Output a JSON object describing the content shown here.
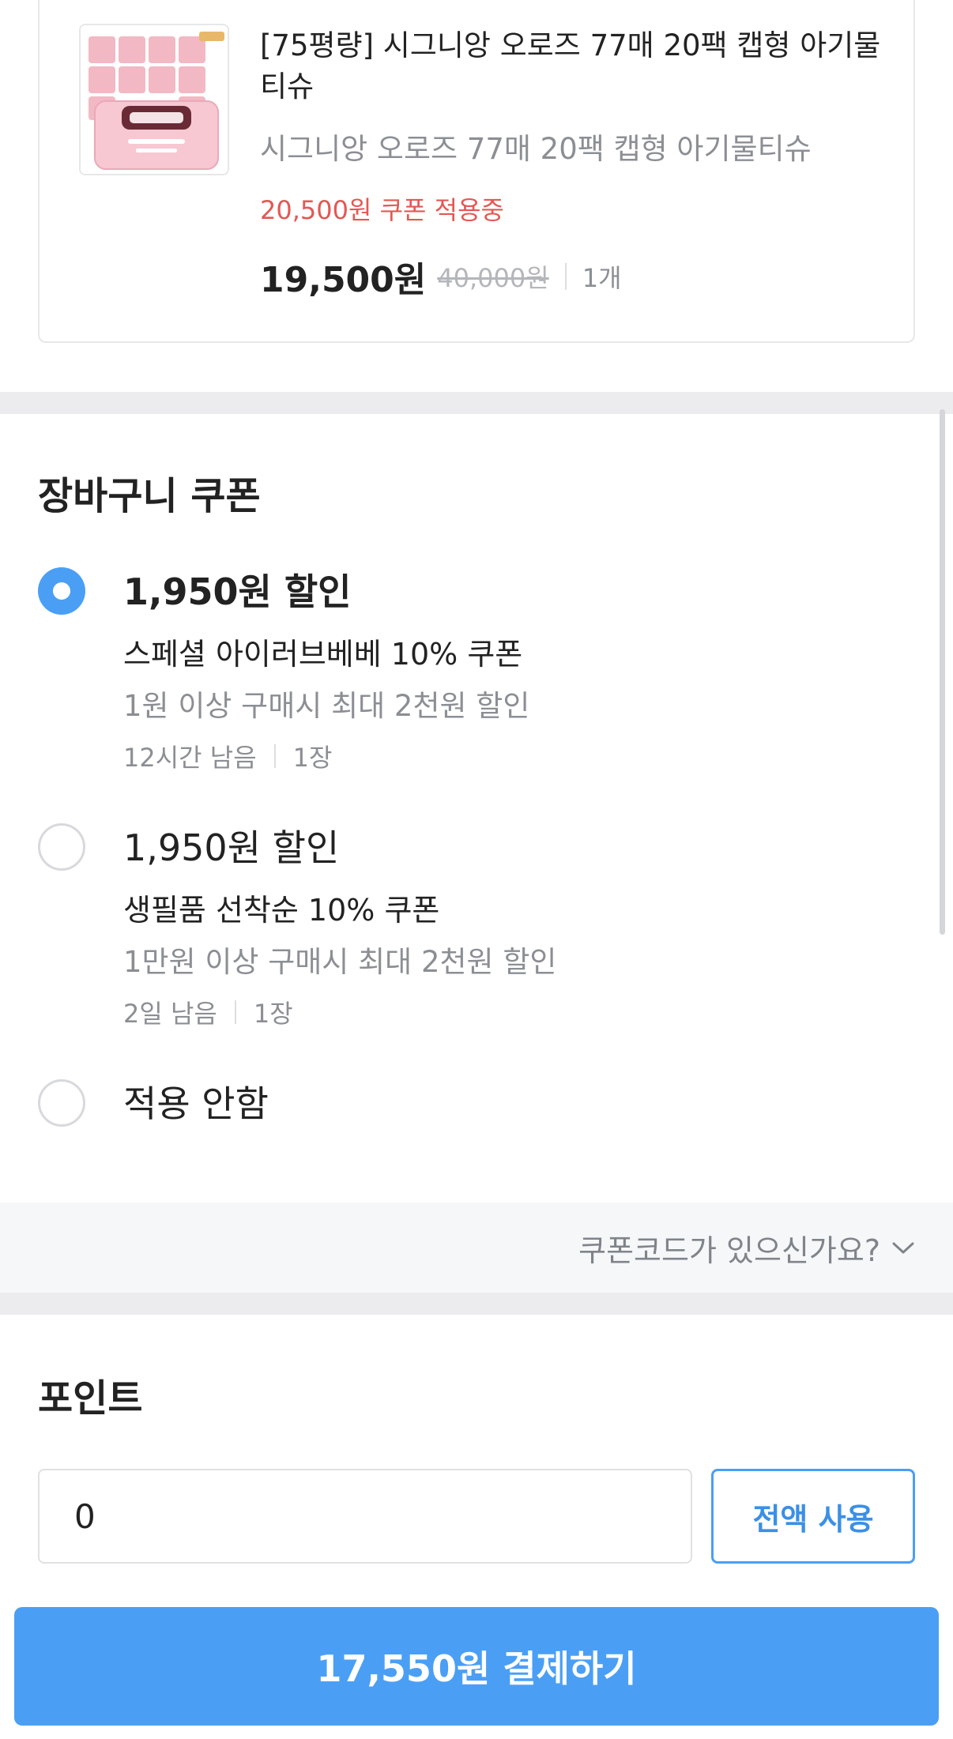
{
  "product": {
    "title": "[75평량] 시그니앙 오로즈 77매 20팩 캡형 아기물티슈",
    "option": "시그니앙 오로즈 77매 20팩 캡형 아기물티슈",
    "coupon_status": "20,500원 쿠폰 적용중",
    "price": "19,500원",
    "original_price": "40,000원",
    "quantity": "1개",
    "thumbnail_icon": "wet-wipes-product-image"
  },
  "cart_coupon": {
    "title": "장바구니 쿠폰",
    "options": [
      {
        "amount": "1,950원 할인",
        "name": "스페셜 아이러브베베 10% 쿠폰",
        "condition": "1원 이상 구매시 최대 2천원 할인",
        "remaining": "12시간 남음",
        "count": "1장",
        "selected": true
      },
      {
        "amount": "1,950원 할인",
        "name": "생필품 선착순 10% 쿠폰",
        "condition": "1만원 이상 구매시 최대 2천원 할인",
        "remaining": "2일 남음",
        "count": "1장",
        "selected": false
      },
      {
        "amount": "적용 안함",
        "selected": false
      }
    ],
    "coupon_code_link": "쿠폰코드가 있으신가요?"
  },
  "points": {
    "title": "포인트",
    "value": "0",
    "use_all_label": "전액 사용"
  },
  "checkout": {
    "pay_label": "17,550원 결제하기"
  },
  "colors": {
    "accent": "#4a9ff5",
    "coupon_red": "#e45754",
    "muted_text": "#8b8f94"
  }
}
